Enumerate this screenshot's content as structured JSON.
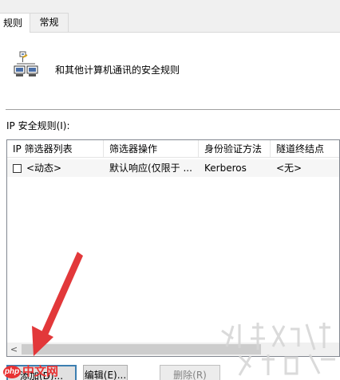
{
  "tabs": [
    {
      "label": "规则",
      "active": true
    },
    {
      "label": "常规",
      "active": false
    }
  ],
  "header": {
    "icon": "network-computers-icon",
    "description": "和其他计算机通讯的安全规则"
  },
  "rules_list": {
    "title": "IP 安全规则(I):",
    "columns": [
      "IP 筛选器列表",
      "筛选器操作",
      "身份验证方法",
      "隧道终结点"
    ],
    "rows": [
      {
        "checked": false,
        "filter_list": "<动态>",
        "filter_action": "默认响应(仅限于 ...",
        "auth_method": "Kerberos",
        "tunnel_endpoint": "<无>"
      }
    ],
    "scroll_left_arrow": "<"
  },
  "buttons": {
    "add": "添加(D)...",
    "edit": "编辑(E)...",
    "remove": "删除(R)"
  },
  "annotation": {
    "type": "arrow",
    "color": "#e2383a",
    "points_to": "add-button"
  },
  "watermark": {
    "badge": "php",
    "text": "中文网"
  }
}
